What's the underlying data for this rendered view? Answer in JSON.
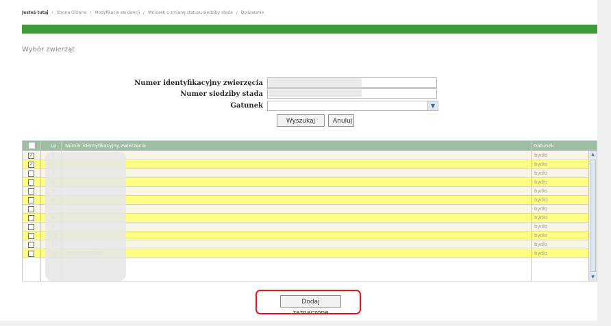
{
  "breadcrumb": {
    "items": [
      "Jesteś tutaj",
      "Strona Główna",
      "Modyfikacje ewidencji",
      "Wniosek o zmianę statusu siedziby stada",
      "Dodawanie"
    ]
  },
  "section": {
    "title": "Wybór zwierząt"
  },
  "form": {
    "id_label": "Numer identyfikacyjny zwierzęcia",
    "herd_label": "Numer siedziby stada",
    "species_label": "Gatunek",
    "id_value": "",
    "herd_value": "",
    "species_value": ""
  },
  "buttons": {
    "search": "Wyszukaj",
    "cancel": "Anuluj",
    "add_selected": "Dodaj zaznaczone"
  },
  "table": {
    "headers": {
      "lp": "Lp.",
      "id": "Numer identyfikacyjny zwierzęcia",
      "species": "Gatunek"
    },
    "rows": [
      {
        "lp": "1",
        "checked": true,
        "species": "bydło",
        "id": ""
      },
      {
        "lp": "2",
        "checked": true,
        "species": "bydło",
        "id": ""
      },
      {
        "lp": "3",
        "checked": false,
        "species": "bydło",
        "id": ""
      },
      {
        "lp": "4",
        "checked": false,
        "species": "bydło",
        "id": ""
      },
      {
        "lp": "5",
        "checked": false,
        "species": "bydło",
        "id": ""
      },
      {
        "lp": "6",
        "checked": false,
        "species": "bydło",
        "id": ""
      },
      {
        "lp": "7",
        "checked": false,
        "species": "bydło",
        "id": ""
      },
      {
        "lp": "8",
        "checked": false,
        "species": "bydło",
        "id": ""
      },
      {
        "lp": "9",
        "checked": false,
        "species": "bydło",
        "id": ""
      },
      {
        "lp": "10",
        "checked": false,
        "species": "bydło",
        "id": ""
      },
      {
        "lp": "11",
        "checked": false,
        "species": "bydło",
        "id": ""
      },
      {
        "lp": "12",
        "checked": false,
        "species": "bydło",
        "id": "PL0000000000"
      }
    ]
  },
  "icons": {
    "select_arrow": "chevron-down-icon",
    "scroll_up": "chevron-up-icon",
    "scroll_down": "chevron-down-icon"
  },
  "colors": {
    "green_bar": "#3f9b3a",
    "table_header": "#9ebda3",
    "row_yellow": "#ffff84",
    "row_beige": "#f8f5e4",
    "callout": "#e3141a"
  }
}
